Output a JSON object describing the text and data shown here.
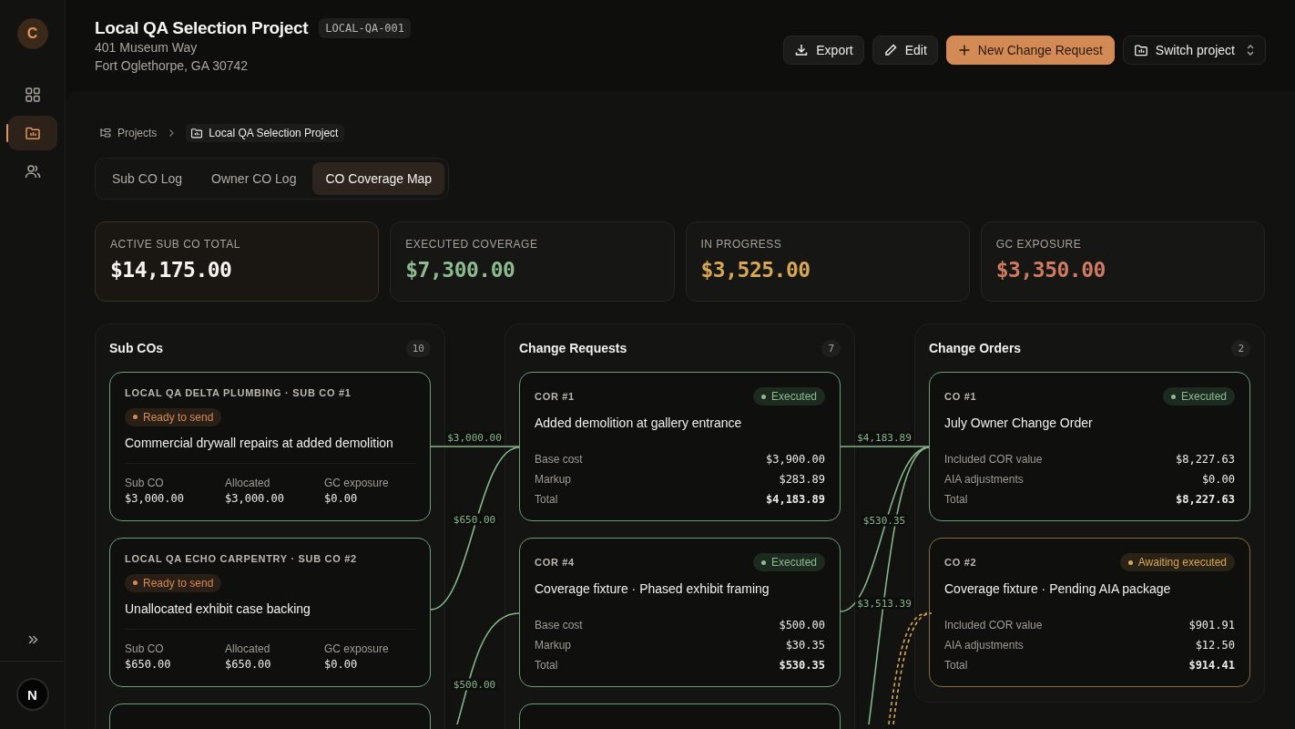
{
  "sidebar": {
    "avatar": "C",
    "nav": [
      {
        "selected": false
      },
      {
        "selected": true
      },
      {
        "selected": false
      }
    ],
    "workspace": "N"
  },
  "header": {
    "title": "Local QA Selection Project",
    "code": "LOCAL-QA-001",
    "address": [
      "401 Museum Way",
      "Fort Oglethorpe, GA 30742"
    ],
    "actions": [
      {
        "label": "Export",
        "kind": "export"
      },
      {
        "label": "Edit",
        "kind": "edit"
      },
      {
        "label": "New Change Request",
        "kind": "new"
      },
      {
        "label": "Switch project",
        "kind": "switch"
      }
    ]
  },
  "breadcrumb": [
    "Projects",
    "Local QA Selection Project"
  ],
  "tabs": [
    {
      "label": "Sub CO Log",
      "selected": false
    },
    {
      "label": "Owner CO Log",
      "selected": false
    },
    {
      "label": "CO Coverage Map",
      "selected": true
    }
  ],
  "stats": [
    {
      "label": "ACTIVE SUB CO TOTAL",
      "value": "$14,175.00",
      "kind": "total"
    },
    {
      "label": "EXECUTED COVERAGE",
      "value": "$7,300.00",
      "kind": "executed"
    },
    {
      "label": "IN PROGRESS",
      "value": "$3,525.00",
      "kind": "progress"
    },
    {
      "label": "GC EXPOSURE",
      "value": "$3,350.00",
      "kind": "exposure"
    }
  ],
  "columns": [
    {
      "title": "Sub COs",
      "count": "10",
      "kind": "sub",
      "cards": [
        {
          "kind": "item",
          "heading": "LOCAL QA DELTA PLUMBING · SUB CO #1",
          "status": {
            "label": "Ready to send",
            "kind": "ready"
          },
          "title": "Commercial drywall repairs at added demolition",
          "figures": [
            {
              "label": "Sub CO",
              "value": "$3,000.00"
            },
            {
              "label": "Allocated",
              "value": "$3,000.00"
            },
            {
              "label": "GC exposure",
              "value": "$0.00"
            }
          ]
        },
        {
          "kind": "item",
          "heading": "LOCAL QA ECHO CARPENTRY · SUB CO #2",
          "status": {
            "label": "Ready to send",
            "kind": "ready"
          },
          "title": "Unallocated exhibit case backing",
          "figures": [
            {
              "label": "Sub CO",
              "value": "$650.00"
            },
            {
              "label": "Allocated",
              "value": "$650.00"
            },
            {
              "label": "GC exposure",
              "value": "$0.00"
            }
          ]
        },
        {
          "kind": "stub"
        }
      ]
    },
    {
      "title": "Change Requests",
      "count": "7",
      "kind": "cor",
      "cards": [
        {
          "kind": "item",
          "heading": "COR #1",
          "status": {
            "label": "Executed",
            "kind": "executed"
          },
          "title": "Added demolition at gallery entrance",
          "figures": [
            {
              "label": "Base cost",
              "value": "$3,900.00"
            },
            {
              "label": "Markup",
              "value": "$283.89"
            },
            {
              "label": "Total",
              "value": "$4,183.89"
            }
          ]
        },
        {
          "kind": "item",
          "heading": "COR #4",
          "status": {
            "label": "Executed",
            "kind": "executed"
          },
          "title": "Coverage fixture · Phased exhibit framing",
          "figures": [
            {
              "label": "Base cost",
              "value": "$500.00"
            },
            {
              "label": "Markup",
              "value": "$30.35"
            },
            {
              "label": "Total",
              "value": "$530.35"
            }
          ]
        },
        {
          "kind": "stub"
        }
      ]
    },
    {
      "title": "Change Orders",
      "count": "2",
      "kind": "co",
      "cards": [
        {
          "kind": "item",
          "heading": "CO #1",
          "status": {
            "label": "Executed",
            "kind": "executed"
          },
          "title": "July Owner Change Order",
          "figures": [
            {
              "label": "Included COR value",
              "value": "$8,227.63"
            },
            {
              "label": "AIA adjustments",
              "value": "$0.00"
            },
            {
              "label": "Total",
              "value": "$8,227.63"
            }
          ]
        },
        {
          "kind": "item",
          "heading": "CO #2",
          "status": {
            "label": "Awaiting executed",
            "kind": "awaiting"
          },
          "title": "Coverage fixture · Pending AIA package",
          "figures": [
            {
              "label": "Included COR value",
              "value": "$901.91"
            },
            {
              "label": "AIA adjustments",
              "value": "$12.50"
            },
            {
              "label": "Total",
              "value": "$914.41"
            }
          ]
        }
      ]
    }
  ],
  "flows": [
    {
      "label": "$3,000.00",
      "kind": "executed"
    },
    {
      "label": "$650.00",
      "kind": "executed"
    },
    {
      "label": "$500.00",
      "kind": "executed"
    },
    {
      "label": "$4,183.89",
      "kind": "executed"
    },
    {
      "label": "$530.35",
      "kind": "executed"
    },
    {
      "label": "$3,513.39",
      "kind": "executed"
    },
    {
      "kind": "pending"
    }
  ]
}
